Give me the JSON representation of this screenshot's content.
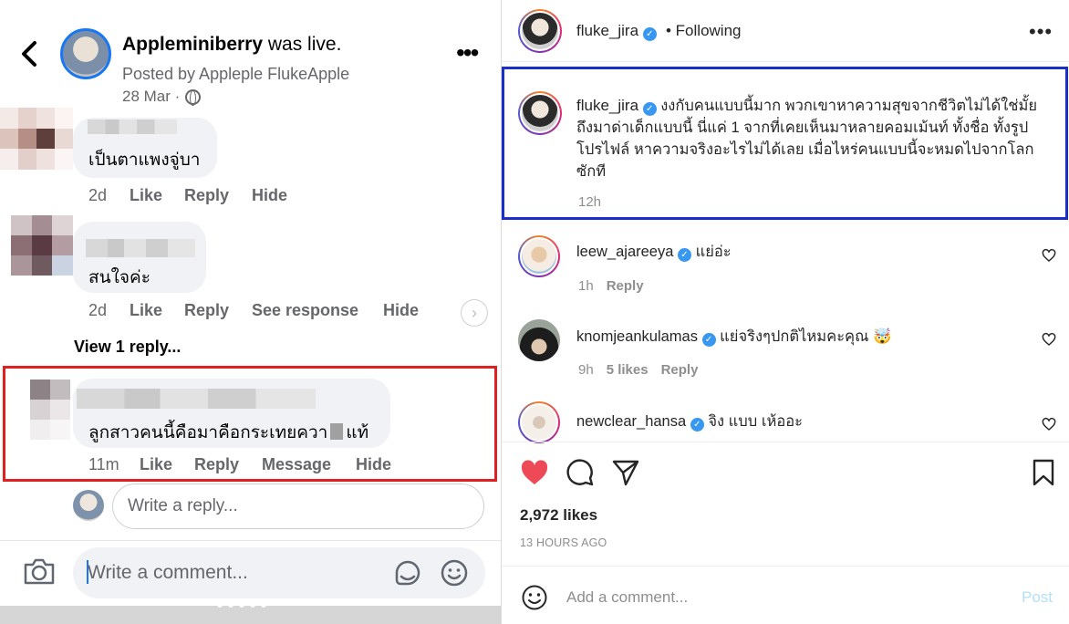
{
  "facebook": {
    "header": {
      "page_name": "Appleminiberry",
      "title_suffix": " was live.",
      "posted_by": "Posted by Appleple FlukeApple",
      "date": "28 Mar ·"
    },
    "comments": [
      {
        "text": "เป็นตาแพงจู่บา",
        "time": "2d",
        "actions": [
          "Like",
          "Reply",
          "Hide"
        ]
      },
      {
        "text": "สนใจค่ะ",
        "time": "2d",
        "actions": [
          "Like",
          "Reply",
          "See response",
          "Hide"
        ]
      }
    ],
    "view_replies": "View 1 reply...",
    "highlighted_comment": {
      "text": "ลูกสาวคนนี้คือมาคือกระเทยควา",
      "text_after": "แท้",
      "time": "11m",
      "actions": [
        "Like",
        "Reply",
        "Message",
        "Hide"
      ]
    },
    "reply_placeholder": "Write a reply...",
    "comment_placeholder": "Write a comment...",
    "highlight_color": "#e02020",
    "accent_color": "#1877f2"
  },
  "instagram": {
    "header": {
      "username": "fluke_jira",
      "follow_status": "• Following"
    },
    "caption": {
      "username": "fluke_jira",
      "text": "งงกับคนแบบนี้มาก พวกเขาหาความสุขจากชีวิตไม่ได้ใช่มั้ย ถึงมาด่าเด็กแบบนี้ นี่แค่ 1 จากที่เคยเห็นมาหลายคอมเม้นท์ ทั้งชื่อ ทั้งรูปโปรไฟล์ หาความจริงอะไรไม่ได้เลย เมื่อไหร่คนแบบนี้จะหมดไปจากโลกซักที",
      "time": "12h"
    },
    "comments": [
      {
        "username": "leew_ajareeya",
        "text": "แย่อ่ะ",
        "time": "1h",
        "likes": "",
        "reply": "Reply"
      },
      {
        "username": "knomjeankulamas",
        "text": "แย่จริงๆปกติไหมคะคุณ 🤯",
        "time": "9h",
        "likes": "5 likes",
        "reply": "Reply"
      },
      {
        "username": "newclear_hansa",
        "text": "จิง แบบ เห้ออะ",
        "time": "",
        "likes": "",
        "reply": ""
      }
    ],
    "likes": "2,972 likes",
    "time_ago": "13 HOURS AGO",
    "add_comment_placeholder": "Add a comment...",
    "post_label": "Post",
    "highlight_color": "#1a2ecc",
    "like_color": "#ed4956"
  }
}
